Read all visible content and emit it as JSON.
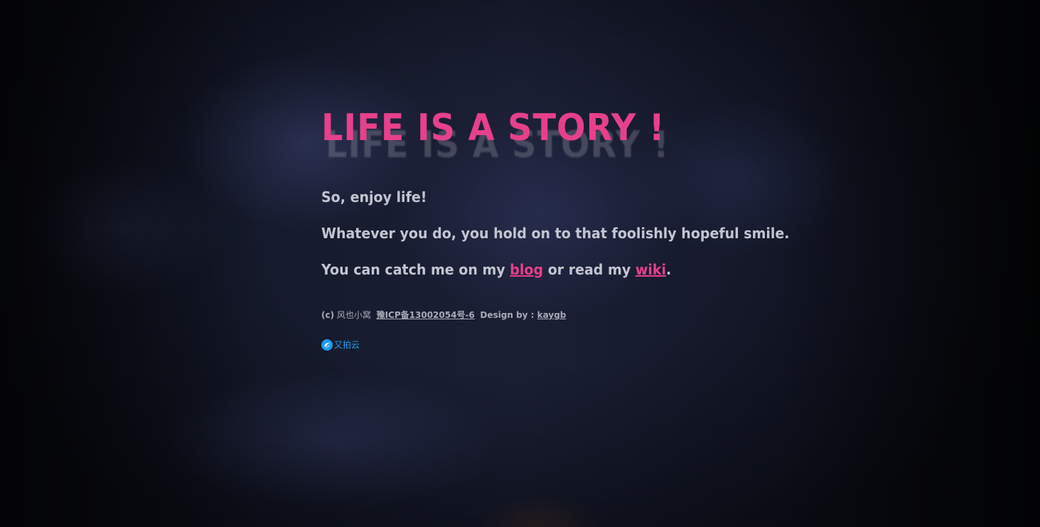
{
  "hero": {
    "title": "LIFE IS A STORY !"
  },
  "lines": {
    "line1": "So, enjoy life!",
    "line2": "Whatever you do, you hold on to that foolishly hopeful smile.",
    "line3_prefix": "You can catch me on my ",
    "blog_link": "blog",
    "line3_middle": " or read my ",
    "wiki_link": "wiki",
    "line3_suffix": "."
  },
  "footer": {
    "copyright_symbol": "(c)",
    "site_name": "风也小窝",
    "icp_link": "豫ICP备13002054号-6",
    "design_prefix": "Design by : ",
    "designer_link": "kaygb"
  },
  "sponsor": {
    "label": "又拍云",
    "icon": "upyun-logo-icon"
  },
  "colors": {
    "accent": "#e7408b",
    "text": "#c3c5d1",
    "sponsor": "#1e9bf0"
  }
}
